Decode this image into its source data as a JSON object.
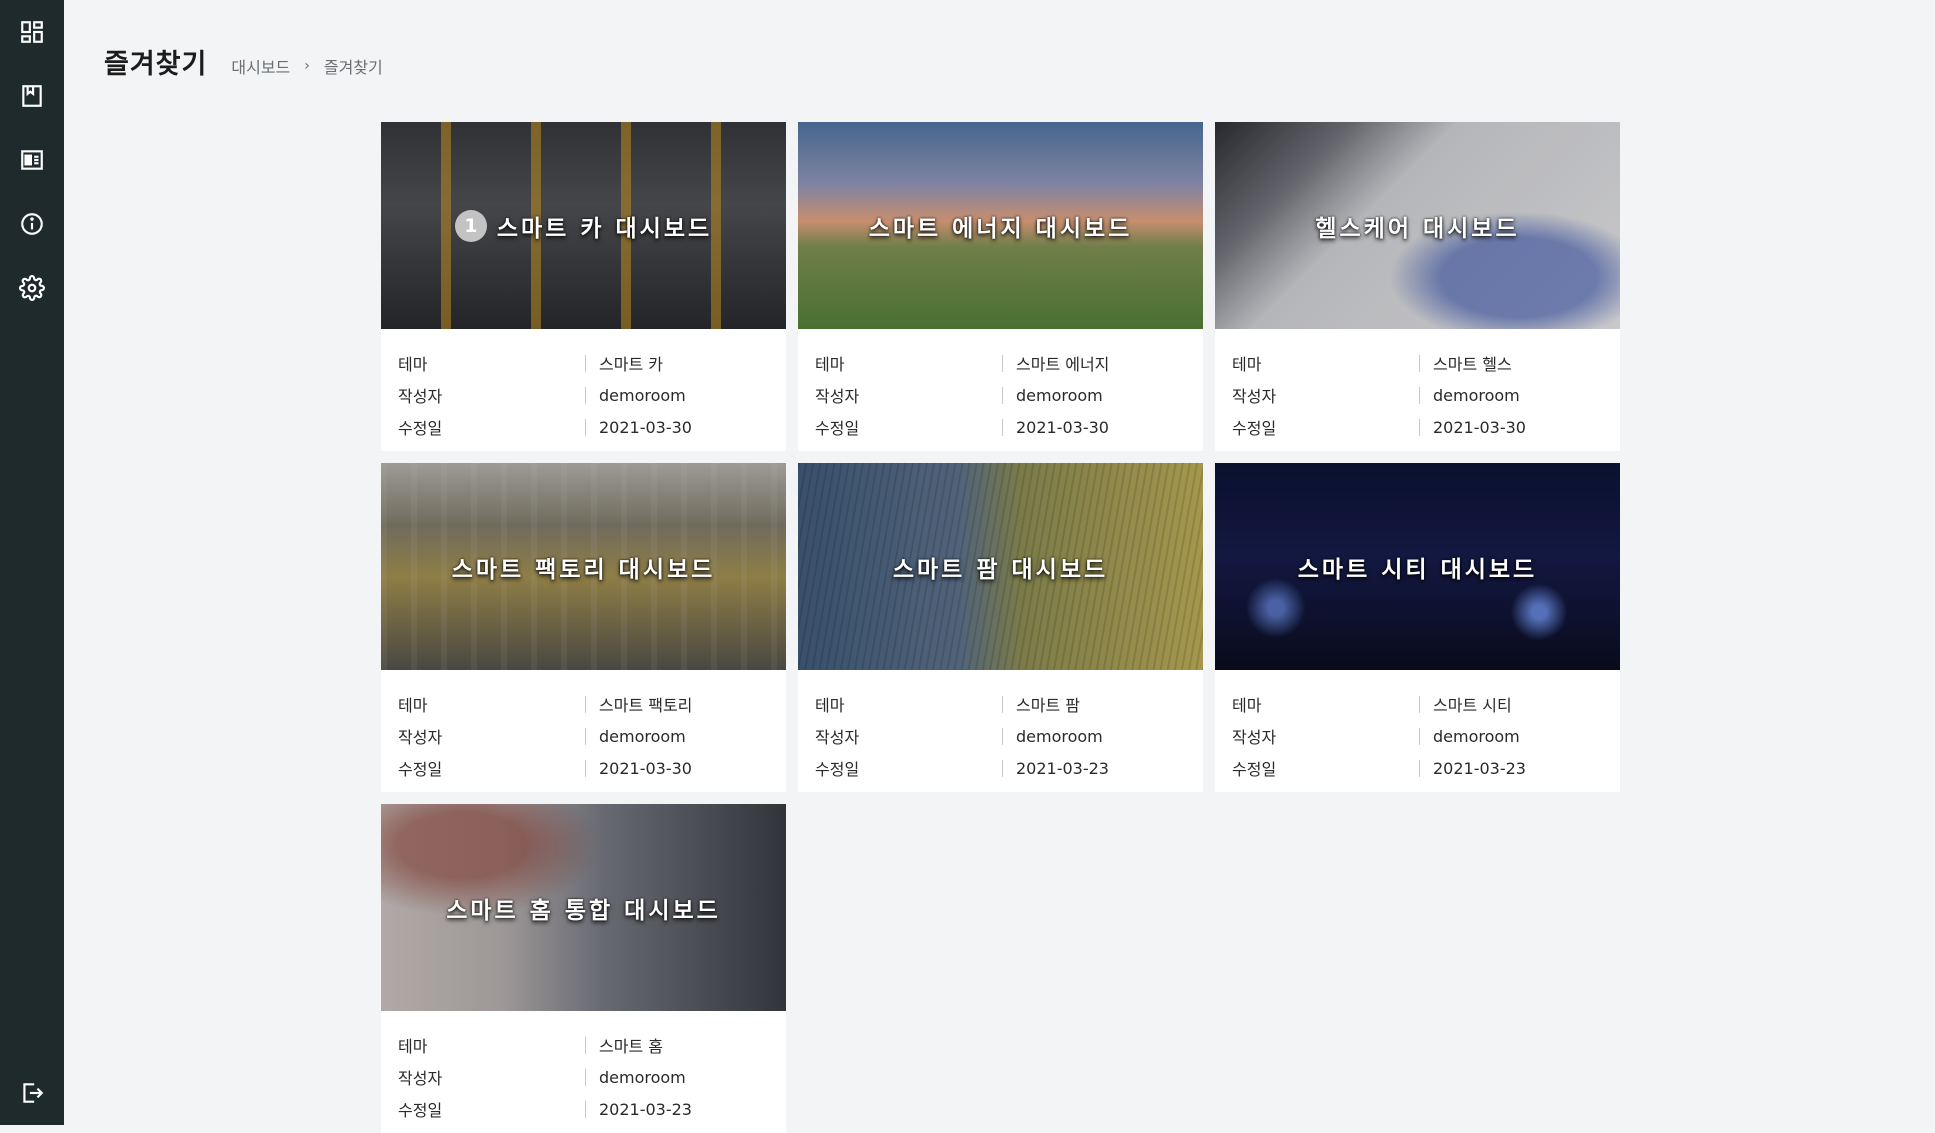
{
  "nav": {
    "items": [
      {
        "icon": "dashboard-grid-icon",
        "name": "nav-dashboard"
      },
      {
        "icon": "bookmark-icon",
        "name": "nav-favorites"
      },
      {
        "icon": "dashboard-list-icon",
        "name": "nav-dashboard-list"
      },
      {
        "icon": "info-icon",
        "name": "nav-info"
      },
      {
        "icon": "gear-icon",
        "name": "nav-settings"
      }
    ],
    "logout_icon": "logout-icon"
  },
  "header": {
    "title": "즐겨찾기",
    "breadcrumb": [
      "대시보드",
      "즐겨찾기"
    ],
    "breadcrumb_separator": "›"
  },
  "labels": {
    "theme": "테마",
    "author": "작성자",
    "modified": "수정일"
  },
  "cards": [
    {
      "title": "스마트 카 대시보드",
      "badge": "1",
      "theme": "스마트 카",
      "author": "demoroom",
      "modified": "2021-03-30",
      "image": "city-intersection-aerial"
    },
    {
      "title": "스마트 에너지 대시보드",
      "theme": "스마트 에너지",
      "author": "demoroom",
      "modified": "2021-03-30",
      "image": "wind-turbines-sunset"
    },
    {
      "title": "헬스케어 대시보드",
      "theme": "스마트 헬스",
      "author": "demoroom",
      "modified": "2021-03-30",
      "image": "laptop-stethoscope"
    },
    {
      "title": "스마트 팩토리 대시보드",
      "theme": "스마트 팩토리",
      "author": "demoroom",
      "modified": "2021-03-30",
      "image": "factory-assembly-line"
    },
    {
      "title": "스마트 팜 대시보드",
      "theme": "스마트 팜",
      "author": "demoroom",
      "modified": "2021-03-23",
      "image": "farm-field-aerial"
    },
    {
      "title": "스마트 시티 대시보드",
      "theme": "스마트 시티",
      "author": "demoroom",
      "modified": "2021-03-23",
      "image": "city-night-skyline"
    },
    {
      "title": "스마트 홈 통합 대시보드",
      "theme": "스마트 홈",
      "author": "demoroom",
      "modified": "2021-03-23",
      "image": "woman-holding-phone"
    }
  ],
  "colors": {
    "sidebar": "#1e2a2c",
    "page_bg": "#f3f4f6",
    "card_bg": "#ffffff"
  }
}
